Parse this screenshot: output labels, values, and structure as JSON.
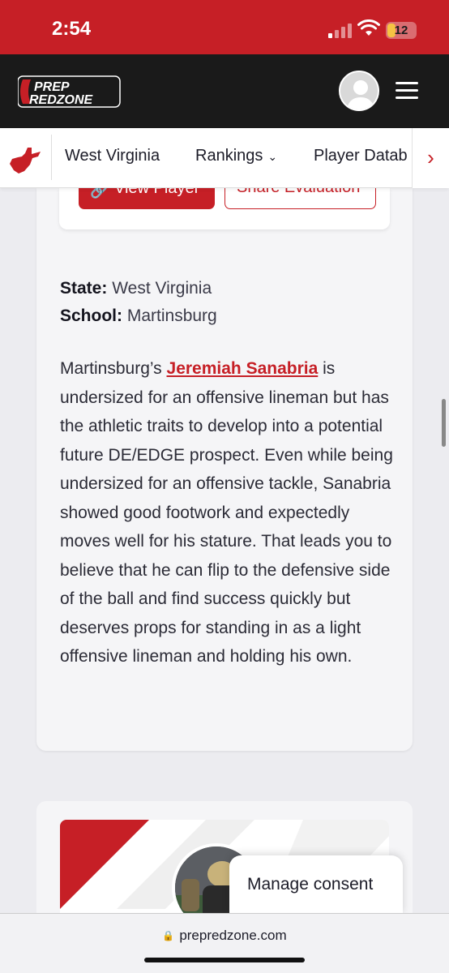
{
  "status_bar": {
    "time": "2:54",
    "battery": "12"
  },
  "header": {
    "logo_top": "PREP",
    "logo_bottom": "REDZONE"
  },
  "nav": {
    "items": [
      {
        "label": "West Virginia"
      },
      {
        "label": "Rankings",
        "icon": "chevron-down-icon"
      },
      {
        "label": "Player Datab"
      }
    ]
  },
  "buttons": {
    "view_player": "View Player",
    "share_evaluation": "Share Evaluation"
  },
  "article": {
    "state_label": "State:",
    "state_value": "West Virginia",
    "school_label": "School:",
    "school_value": "Martinsburg",
    "para_start": "Martinsburg’s",
    "player_link": "Jeremiah Sanabria",
    "para_rest": "is undersized for an offensive lineman but has the athletic traits to develop into a potential future DE/EDGE prospect. Even while being undersized for an offensive tackle, Sanabria showed good footwork and expectedly moves well for his stature. That leads you to believe that he can flip to the defensive side of the ball and find success quickly but deserves props for standing in as a light offensive lineman and holding his own."
  },
  "consent": {
    "label": "Manage consent"
  },
  "browser": {
    "url": "prepredzone.com"
  },
  "colors": {
    "brand_red": "#c61f26",
    "header_dark": "#1a1a1a"
  }
}
